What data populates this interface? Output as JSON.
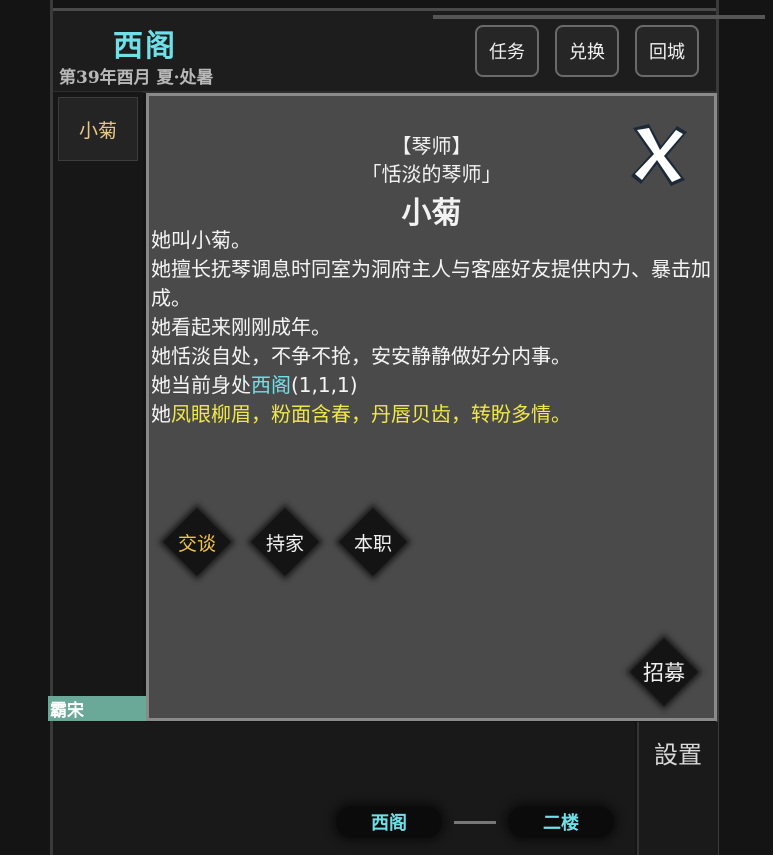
{
  "header": {
    "location": "西阁",
    "date": "第39年酉月 夏·处暑",
    "buttons": [
      "任务",
      "兑换",
      "回城"
    ]
  },
  "sidebar": {
    "selected_item": "小菊",
    "tag": "霸宋"
  },
  "dialog": {
    "role": "【琴师】",
    "epithet": "「恬淡的琴师」",
    "name": "小菊",
    "desc": {
      "line1": "她叫小菊。",
      "line2": "她擅长抚琴调息时同室为洞府主人与客座好友提供内力、暴击加成。",
      "line3": "她看起来刚刚成年。",
      "line4": "她恬淡自处，不争不抢，安安静静做好分内事。",
      "line5_prefix": "她当前身处",
      "line5_place": "西阁",
      "line5_suffix": "(1,1,1)",
      "line6_prefix": "她",
      "line6_highlight": "凤眼柳眉，粉面含春，丹唇贝齿，转盼多情。"
    },
    "actions": {
      "talk": "交谈",
      "housekeep": "持家",
      "duty": "本职"
    },
    "recruit": "招募",
    "close_icon": "close-x-icon"
  },
  "footer": {
    "settings": "設置",
    "floor_left": "西阁",
    "floor_right": "二楼"
  },
  "colors": {
    "cyan": "#6fe0e8",
    "yellow": "#f0e84a",
    "gold": "#f3c24a",
    "tag_bg": "#6aa898"
  }
}
